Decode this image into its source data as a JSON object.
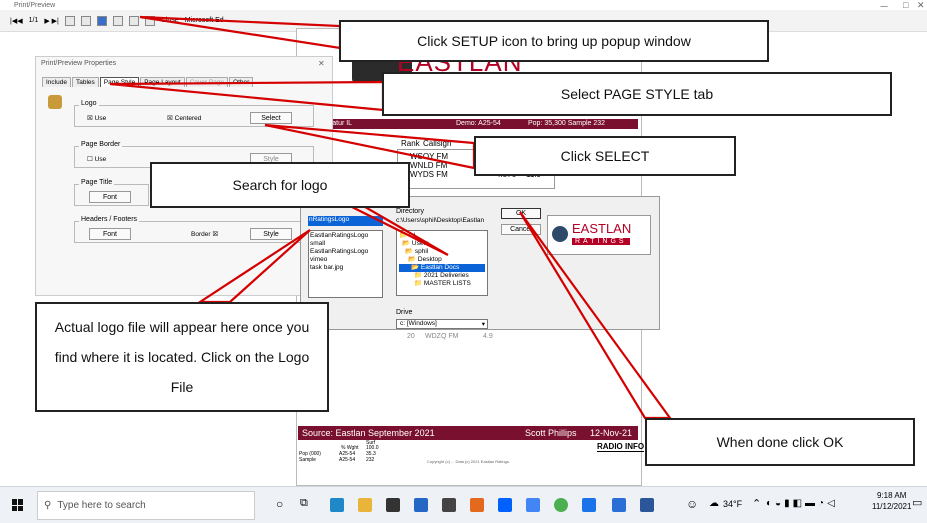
{
  "window": {
    "title": "Print/Preview",
    "toolbar": {
      "page_indicator": "1/1",
      "close_label": "Close",
      "app_label": "Microsoft Ed"
    }
  },
  "properties_dialog": {
    "title": "Print/Preview Properties",
    "tabs": [
      "Include",
      "Tables",
      "Page Style",
      "Page Layout",
      "Cover Page",
      "Other"
    ],
    "logo": {
      "label": "Logo",
      "use": "Use",
      "centered": "Centered",
      "select": "Select"
    },
    "page_border": {
      "label": "Page Border",
      "use": "Use",
      "style": "Style"
    },
    "page_title": {
      "label": "Page Title",
      "font": "Font"
    },
    "headers_footers": {
      "label": "Headers / Footers",
      "font": "Font",
      "border": "Border",
      "style": "Style"
    }
  },
  "report": {
    "logo_text": "EASTLAN",
    "header": {
      "market": "4. Decatur IL",
      "demo": "Demo: A25-54",
      "pop": "Pop: 35,300  Sample 232"
    },
    "columns": [
      "Rank",
      "Callsign"
    ],
    "rows": [
      {
        "call": "WSOY FM",
        "v1": "",
        "v2": ""
      },
      {
        "call": "WNLD FM",
        "v1": "",
        "v2": ""
      },
      {
        "call": "WYDS FM",
        "v1": "4.876",
        "v2": "11.9"
      }
    ],
    "row_20": {
      "rank": "20",
      "call": "WDZQ FM",
      "val": "4.9"
    },
    "footer": {
      "source": "Source: Eastlan September 2021",
      "author": "Scott Phillips",
      "date": "12-Nov-21"
    },
    "table_labels": [
      "% Wght",
      "Pop (000)",
      "Sample"
    ],
    "table_demo": [
      "A25-54",
      "A25-54",
      "A25-54"
    ],
    "table_vals": [
      "100.0",
      "35.3",
      "232"
    ],
    "table_head": "Surf",
    "fineprint": "Copyright (c) ... Data (c) 2021 Eastlan Ratings.",
    "radioinfo": "RADIO INFO"
  },
  "file_dialog": {
    "filename_value": "nRatingsLogo",
    "files": [
      "EastlanRatingsLogo small",
      "EastlanRatingsLogo vimeo",
      "task bar.jpg"
    ],
    "directory_label": "Directory",
    "directory_path": "c:\\Users\\sphil\\Desktop\\Eastlan",
    "folders": [
      "c:\\",
      "Users",
      "sphil",
      "Desktop",
      "Eastlan Docs",
      "2021 Deliveries",
      "MASTER LISTS"
    ],
    "drive_label": "Drive",
    "drive_value": "c: [Windows]",
    "ok": "OK",
    "cancel": "Cancel",
    "logo_preview": {
      "title": "EASTLAN",
      "sub": "RATINGS"
    }
  },
  "callouts": {
    "setup": "Click SETUP icon to bring up popup window",
    "page_style": "Select PAGE STYLE tab",
    "select": "Click SELECT",
    "search": "Search for logo",
    "actual": "Actual logo file will appear here once you find where it is located.  Click on the Logo File",
    "ok": "When done click OK"
  },
  "taskbar": {
    "search_placeholder": "Type here to search",
    "weather": "34°F",
    "time": "9:18 AM",
    "date": "11/12/2021"
  },
  "colors": {
    "annotation": "#d40000",
    "report_band": "#7a1030",
    "selection": "#0a64d8"
  }
}
